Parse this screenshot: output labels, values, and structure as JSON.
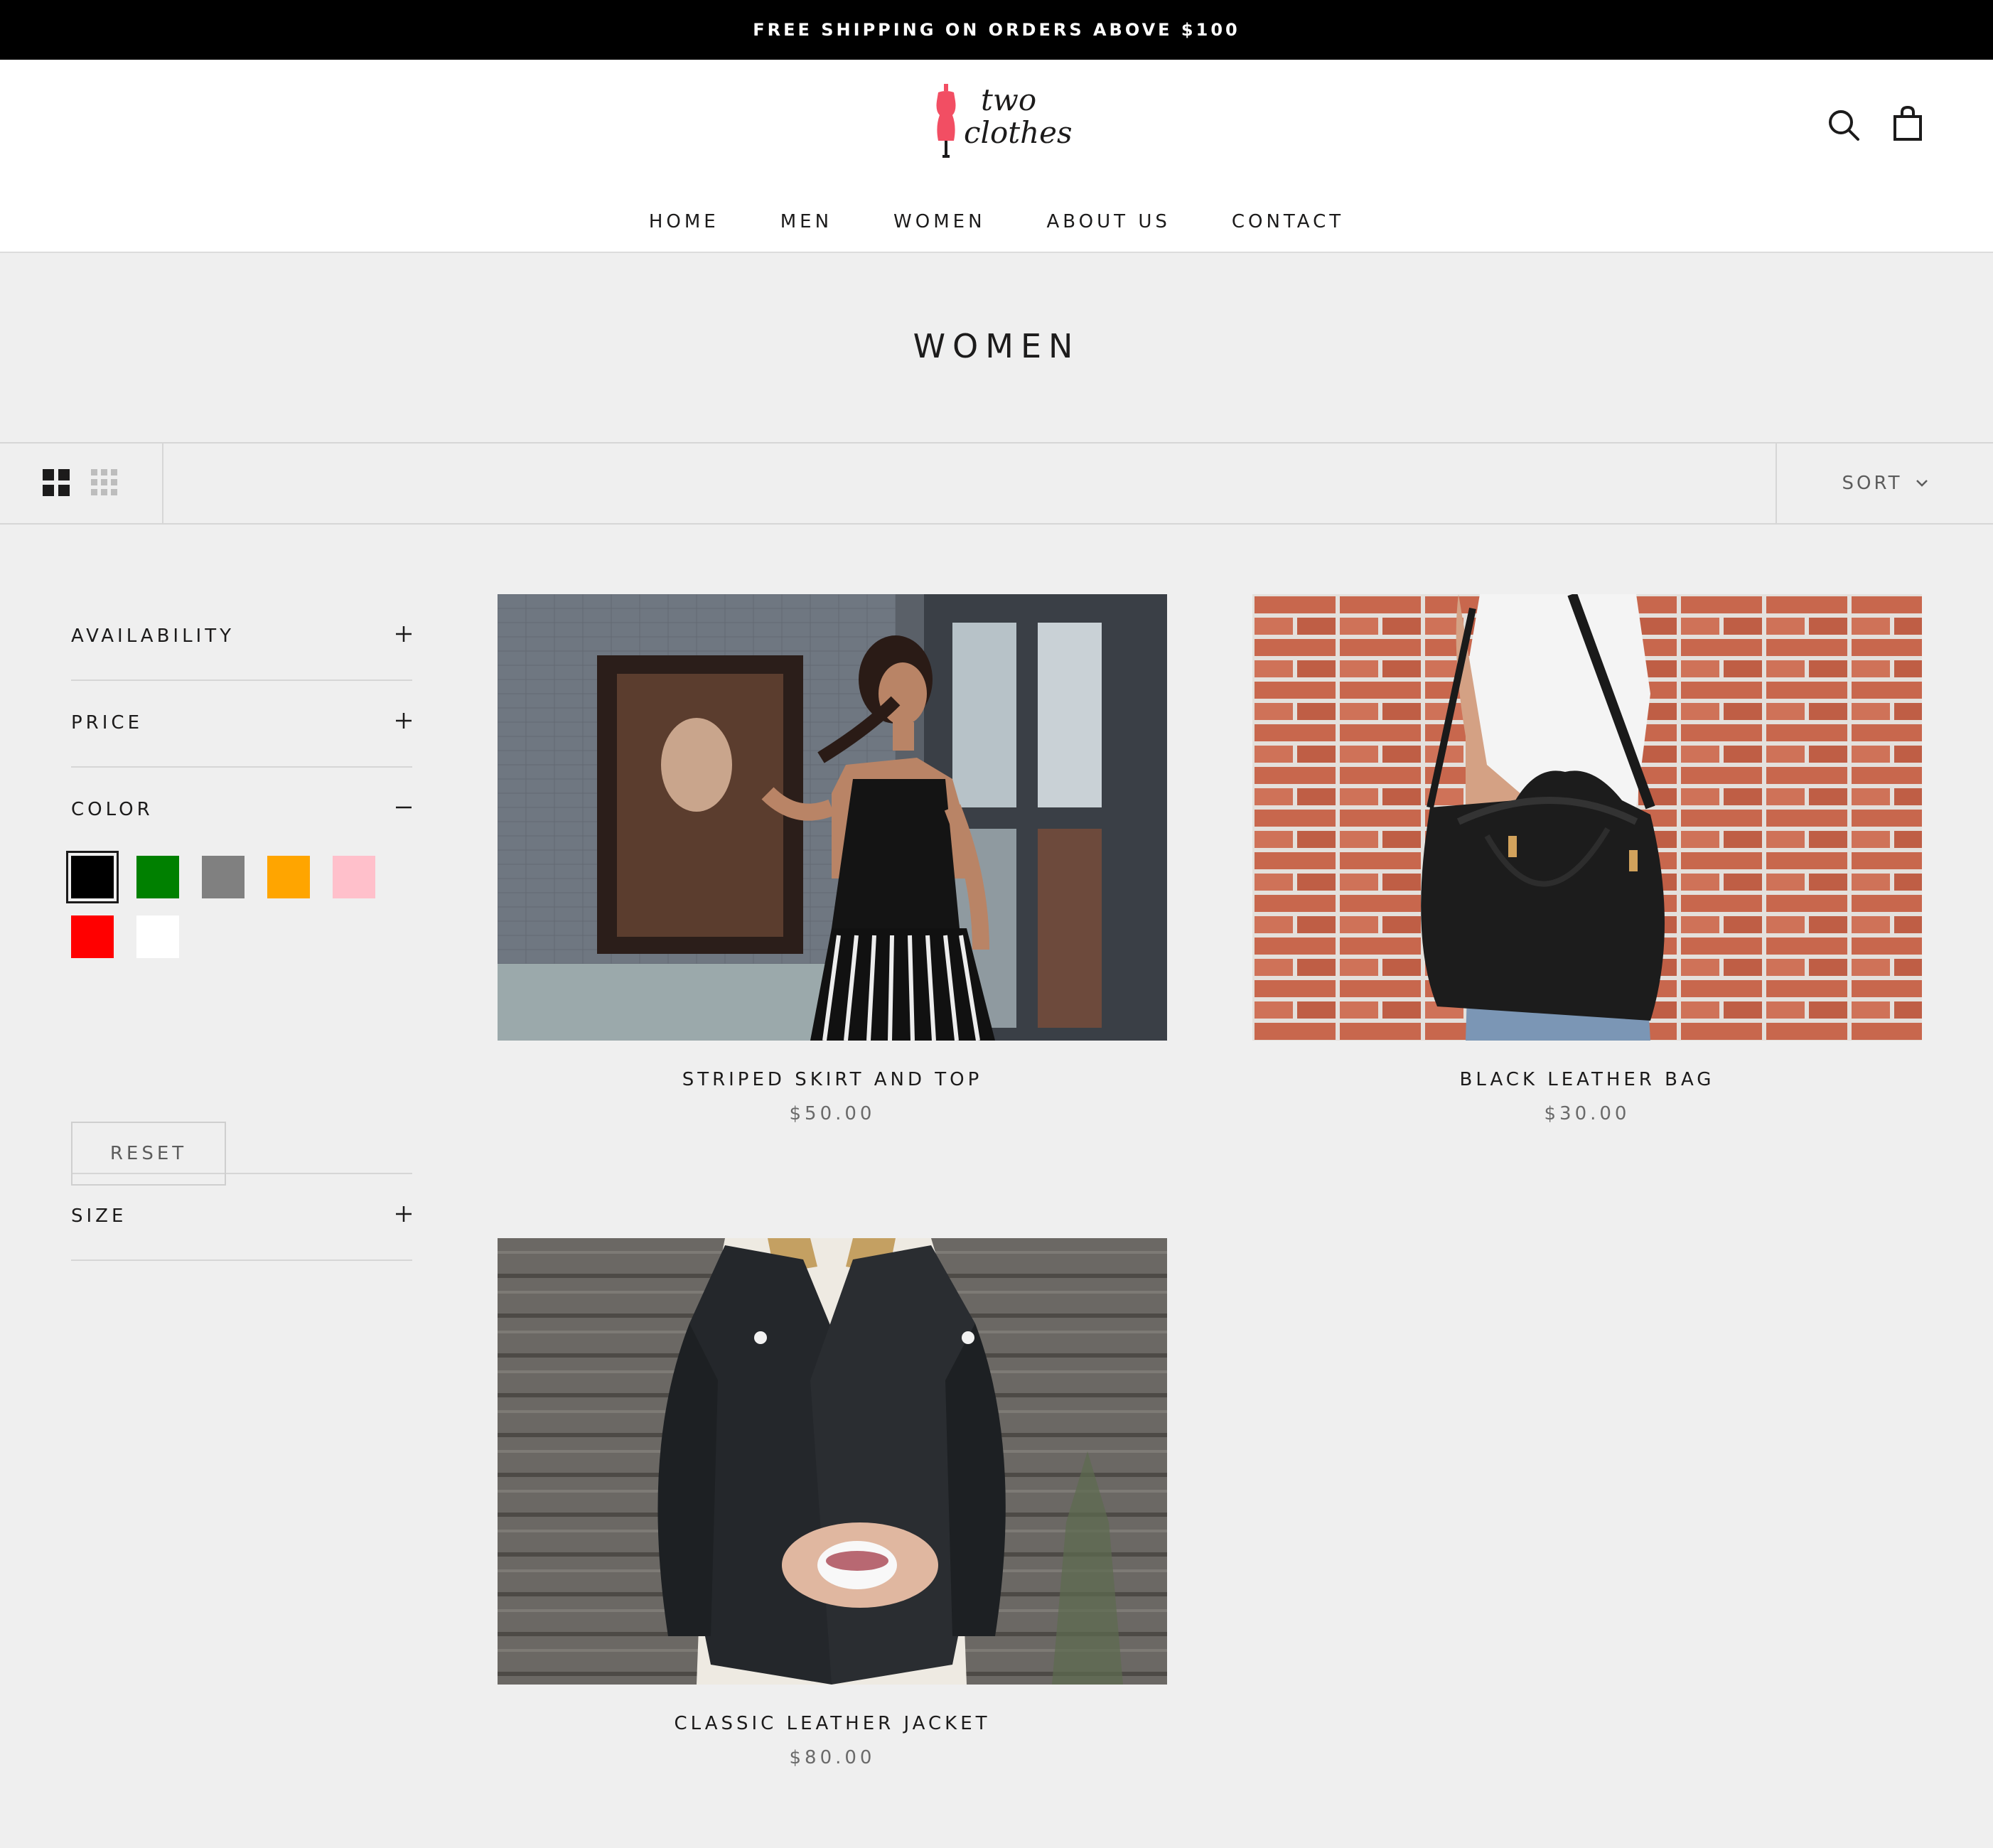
{
  "announcement": "FREE SHIPPING ON ORDERS ABOVE $100",
  "brand": {
    "line1": "two",
    "line2": "clothes",
    "accent": "#f24e63"
  },
  "header": {
    "icons": [
      "search-icon",
      "cart-icon"
    ]
  },
  "nav": [
    "HOME",
    "MEN",
    "WOMEN",
    "ABOUT US",
    "CONTACT"
  ],
  "collection": {
    "title": "WOMEN"
  },
  "toolbar": {
    "views": [
      "grid-2-icon",
      "grid-4-icon"
    ],
    "sort_label": "SORT"
  },
  "filters": {
    "availability": "AVAILABILITY",
    "price": "PRICE",
    "color": "COLOR",
    "size": "SIZE",
    "color_swatches": [
      "#000000",
      "#008000",
      "#808080",
      "#ffa500",
      "#ffc0cb",
      "#ff0000",
      "#ffffff"
    ],
    "selected_swatch": "#000000",
    "reset_label": "RESET"
  },
  "products": [
    {
      "title": "STRIPED SKIRT AND TOP",
      "price": "$50.00"
    },
    {
      "title": "BLACK LEATHER BAG",
      "price": "$30.00"
    },
    {
      "title": "CLASSIC LEATHER JACKET",
      "price": "$80.00"
    }
  ]
}
